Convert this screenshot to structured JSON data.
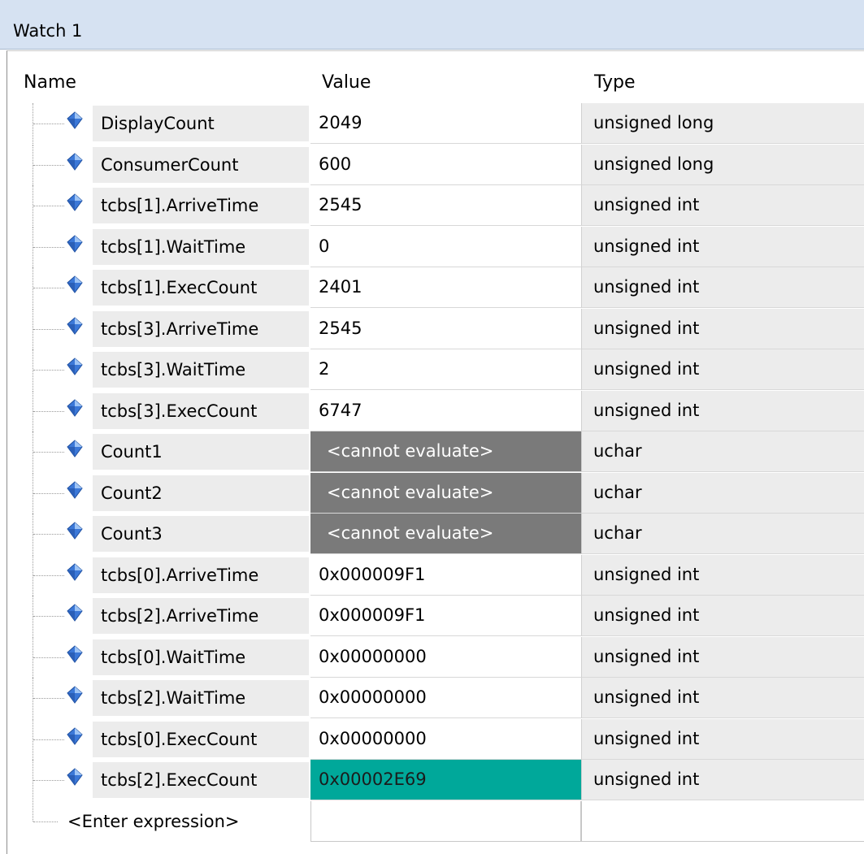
{
  "window": {
    "title": "Watch 1"
  },
  "columns": {
    "name": "Name",
    "value": "Value",
    "type": "Type"
  },
  "rows": [
    {
      "name": "DisplayCount",
      "value": "2049",
      "type": "unsigned long",
      "state": "normal"
    },
    {
      "name": "ConsumerCount",
      "value": "600",
      "type": "unsigned long",
      "state": "normal"
    },
    {
      "name": "tcbs[1].ArriveTime",
      "value": "2545",
      "type": "unsigned int",
      "state": "normal"
    },
    {
      "name": "tcbs[1].WaitTime",
      "value": "0",
      "type": "unsigned int",
      "state": "normal"
    },
    {
      "name": "tcbs[1].ExecCount",
      "value": "2401",
      "type": "unsigned int",
      "state": "normal"
    },
    {
      "name": "tcbs[3].ArriveTime",
      "value": "2545",
      "type": "unsigned int",
      "state": "normal"
    },
    {
      "name": "tcbs[3].WaitTime",
      "value": "2",
      "type": "unsigned int",
      "state": "normal"
    },
    {
      "name": "tcbs[3].ExecCount",
      "value": "6747",
      "type": "unsigned int",
      "state": "normal"
    },
    {
      "name": "Count1",
      "value": "<cannot evaluate>",
      "type": "uchar",
      "state": "cannot-evaluate"
    },
    {
      "name": "Count2",
      "value": "<cannot evaluate>",
      "type": "uchar",
      "state": "cannot-evaluate"
    },
    {
      "name": "Count3",
      "value": "<cannot evaluate>",
      "type": "uchar",
      "state": "cannot-evaluate"
    },
    {
      "name": "tcbs[0].ArriveTime",
      "value": "0x000009F1",
      "type": "unsigned int",
      "state": "normal"
    },
    {
      "name": "tcbs[2].ArriveTime",
      "value": "0x000009F1",
      "type": "unsigned int",
      "state": "normal"
    },
    {
      "name": "tcbs[0].WaitTime",
      "value": "0x00000000",
      "type": "unsigned int",
      "state": "normal"
    },
    {
      "name": "tcbs[2].WaitTime",
      "value": "0x00000000",
      "type": "unsigned int",
      "state": "normal"
    },
    {
      "name": "tcbs[0].ExecCount",
      "value": "0x00000000",
      "type": "unsigned int",
      "state": "normal"
    },
    {
      "name": "tcbs[2].ExecCount",
      "value": "0x00002E69",
      "type": "unsigned int",
      "state": "changed"
    }
  ],
  "enter_expression": {
    "label": "<Enter expression>",
    "value": "",
    "type": ""
  },
  "icons": {
    "variable": "variable-diamond-icon"
  },
  "colors": {
    "title_bar": "#d6e2f2",
    "name_cell_bg": "#ececec",
    "cannot_evaluate_bg": "#7a7a7a",
    "changed_value_bg": "#00a89a",
    "variable_icon": "#3b78d8"
  }
}
